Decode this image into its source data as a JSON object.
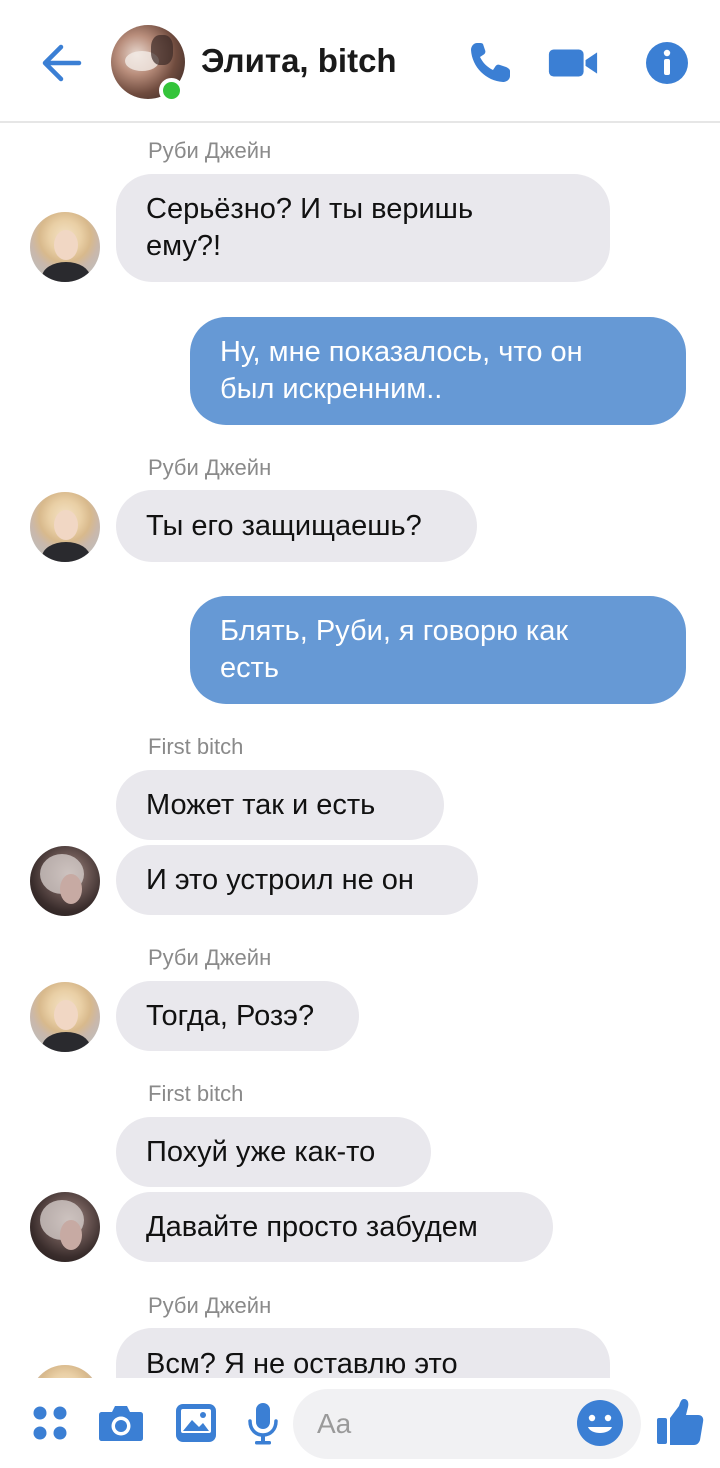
{
  "header": {
    "title": "Элита, bitch",
    "online": true
  },
  "messages": [
    {
      "sender": "Руби Джейн",
      "lines": [
        "Серьёзно? И ты веришь",
        "ему?!"
      ]
    },
    {
      "outgoing": true,
      "lines": [
        "Ну, мне показалось, что он",
        "был искренним.."
      ]
    },
    {
      "sender": "Руби Джейн",
      "lines": [
        "Ты его защищаешь?"
      ]
    },
    {
      "outgoing": true,
      "lines": [
        "Блять, Руби, я говорю как",
        "есть"
      ]
    },
    {
      "sender": "First bitch",
      "lines": [
        "Может так и есть"
      ]
    },
    {
      "sender": "First bitch",
      "lines": [
        "И это устроил не он"
      ]
    },
    {
      "sender": "Руби Джейн",
      "lines": [
        "Тогда, Розэ?"
      ]
    },
    {
      "sender": "First bitch",
      "lines": [
        "Похуй уже как-то"
      ]
    },
    {
      "sender": "First bitch",
      "lines": [
        "Давайте просто забудем"
      ]
    },
    {
      "sender": "Руби Джейн",
      "lines": [
        "Всм? Я не оставлю это"
      ]
    }
  ],
  "composer": {
    "placeholder": "Aa"
  },
  "colors": {
    "accent": "#3b7fd4",
    "outgoing_bubble": "#6699d5",
    "incoming_bubble": "#e9e8ed",
    "online": "#34c43a"
  },
  "icons": [
    "back-arrow-icon",
    "phone-icon",
    "video-camera-icon",
    "info-icon",
    "menu-dots-icon",
    "camera-icon",
    "gallery-icon",
    "microphone-icon",
    "emoji-icon",
    "thumbs-up-icon"
  ]
}
